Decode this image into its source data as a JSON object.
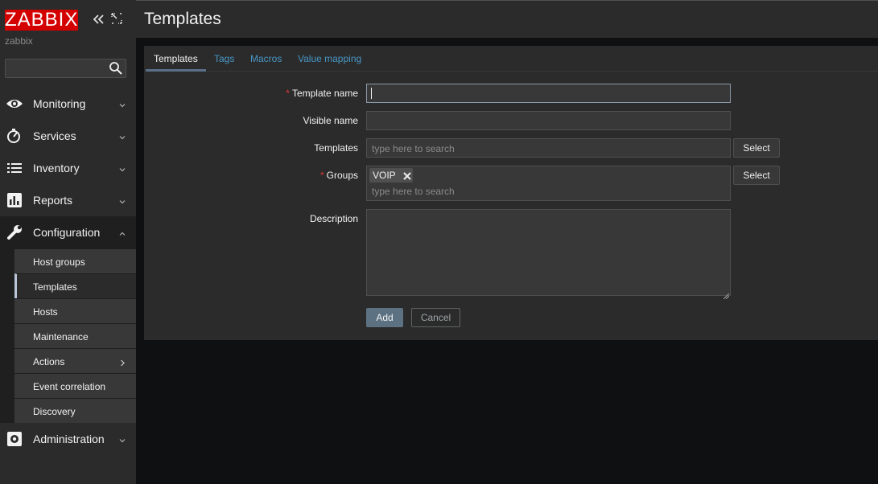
{
  "sidebar": {
    "logo_text": "ZABBIX",
    "server_name": "zabbix",
    "search_placeholder": "",
    "menu": [
      {
        "label": "Monitoring",
        "icon": "eye-icon"
      },
      {
        "label": "Services",
        "icon": "stopwatch-icon"
      },
      {
        "label": "Inventory",
        "icon": "list-icon"
      },
      {
        "label": "Reports",
        "icon": "bar-chart-icon"
      },
      {
        "label": "Configuration",
        "icon": "wrench-icon"
      },
      {
        "label": "Administration",
        "icon": "gear-icon"
      }
    ],
    "submenu": [
      {
        "label": "Host groups"
      },
      {
        "label": "Templates"
      },
      {
        "label": "Hosts"
      },
      {
        "label": "Maintenance"
      },
      {
        "label": "Actions"
      },
      {
        "label": "Event correlation"
      },
      {
        "label": "Discovery"
      }
    ]
  },
  "header": {
    "title": "Templates"
  },
  "tabs": [
    "Templates",
    "Tags",
    "Macros",
    "Value mapping"
  ],
  "form": {
    "template_name_label": "Template name",
    "template_name_value": "",
    "visible_name_label": "Visible name",
    "visible_name_value": "",
    "templates_label": "Templates",
    "templates_placeholder": "type here to search",
    "groups_label": "Groups",
    "groups_chips": [
      "VOIP"
    ],
    "groups_placeholder": "type here to search",
    "description_label": "Description",
    "description_value": "",
    "required_mark": "*",
    "select_label": "Select",
    "add_label": "Add",
    "cancel_label": "Cancel"
  },
  "colors": {
    "brand": "#d40000",
    "link": "#4796c4",
    "primary_button": "#5c7283",
    "required": "#e33734"
  }
}
